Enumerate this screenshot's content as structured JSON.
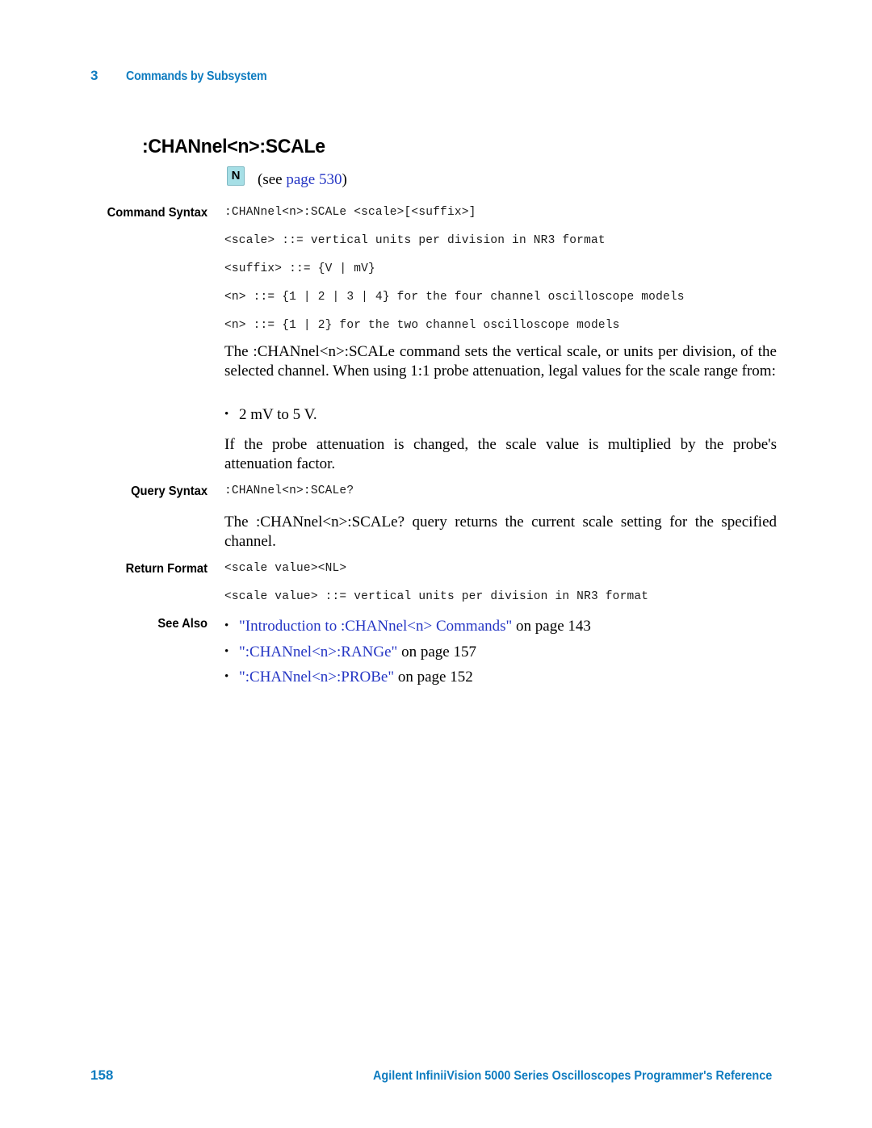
{
  "header": {
    "chapter_number": "3",
    "chapter_title": "Commands by Subsystem"
  },
  "command": {
    "title": ":CHANnel<n>:SCALe",
    "note_badge": "N",
    "note_prefix": "(see ",
    "note_link": "page  530",
    "note_suffix": ")"
  },
  "sections": {
    "command_syntax": {
      "label": "Command Syntax",
      "lines": [
        ":CHANnel<n>:SCALe <scale>[<suffix>]",
        "<scale> ::= vertical units per division in NR3 format",
        "<suffix> ::= {V | mV}",
        "<n> ::= {1 | 2 | 3 | 4} for the four channel oscilloscope models",
        "<n> ::= {1 | 2} for the two channel oscilloscope models"
      ]
    },
    "description": "The :CHANnel<n>:SCALe command sets the vertical scale, or units per division, of the selected channel. When using 1:1 probe attenuation, legal values for the scale range from:",
    "range_bullet": "2 mV to 5 V.",
    "attenuation_note": "If the probe attenuation is changed, the scale value is multiplied by the probe's attenuation factor.",
    "query_syntax": {
      "label": "Query Syntax",
      "line": ":CHANnel<n>:SCALe?"
    },
    "query_description": "The :CHANnel<n>:SCALe? query returns the current scale setting for the specified channel.",
    "return_format": {
      "label": "Return Format",
      "lines": [
        "<scale value><NL>",
        "<scale value> ::= vertical units per division in NR3 format"
      ]
    },
    "see_also": {
      "label": "See Also",
      "items": [
        {
          "link": "\"Introduction to :CHANnel<n> Commands\"",
          "tail": " on page  143"
        },
        {
          "link": "\":CHANnel<n>:RANGe\"",
          "tail": " on page  157"
        },
        {
          "link": "\":CHANnel<n>:PROBe\"",
          "tail": " on page  152"
        }
      ]
    }
  },
  "footer": {
    "page_number": "158",
    "title": "Agilent InfiniiVision 5000 Series Oscilloscopes Programmer's Reference"
  },
  "colors": {
    "brand_blue": "#0f7cc0",
    "link_blue": "#2536c4",
    "badge_bg": "#a6dfe6"
  },
  "bullet_glyph": "•"
}
